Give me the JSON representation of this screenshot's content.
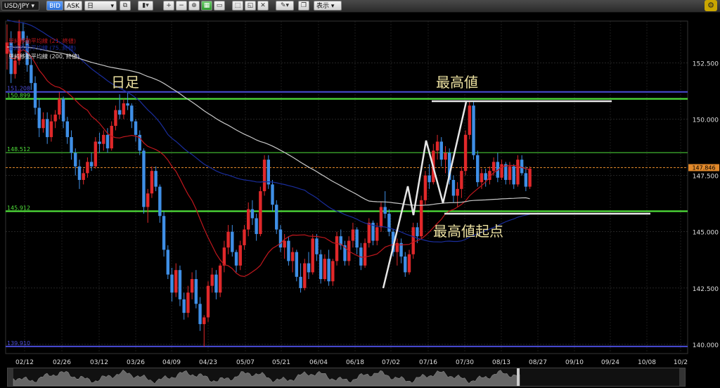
{
  "toolbar": {
    "symbol": "USD/JPY",
    "bid": "BID",
    "ask": "ASK",
    "period": "日",
    "display": "表示"
  },
  "colors": {
    "bull": "#e0282a",
    "bear": "#3f8fe6",
    "ma21": "#c0171d",
    "ma75": "#1a2d9c",
    "ma200": "#c8c8c8",
    "green_line": "#4fe03a",
    "blue_line": "#4a4cd6",
    "annotation": "#ebe0a0"
  },
  "chart_data": {
    "type": "candlestick",
    "instrument": "USD/JPY",
    "timeframe": "daily",
    "ylim": [
      139.9,
      154.5
    ],
    "yticks": [
      "152.500",
      "150.000",
      "147.500",
      "145.000",
      "142.500",
      "140.000"
    ],
    "xticks": [
      "02/12",
      "02/26",
      "03/12",
      "03/26",
      "04/09",
      "04/23",
      "05/07",
      "05/21",
      "06/04",
      "06/18",
      "07/02",
      "07/16",
      "07/30",
      "08/13",
      "08/27",
      "09/10",
      "09/24",
      "10/08",
      "10/2"
    ],
    "legend": [
      {
        "label": "単純移動平均線 (21, 終値)",
        "color": "#c0171d"
      },
      {
        "label": "単純移動平均線 (75, 終値)",
        "color": "#1a2d9c"
      },
      {
        "label": "単純移動平均線 (200, 終値)",
        "color": "#e0e0e0"
      }
    ],
    "horizontal_lines": [
      {
        "label": "151.208",
        "value": 151.208,
        "color": "#4a4cd6"
      },
      {
        "label": "150.899",
        "value": 150.899,
        "color": "#4fe03a"
      },
      {
        "label": "148.512",
        "value": 148.512,
        "color": "#4fe03a"
      },
      {
        "label": "147.846",
        "value": 147.846,
        "color": "#e0882a"
      },
      {
        "label": "145.912",
        "value": 145.912,
        "color": "#4fe03a"
      },
      {
        "label": "139.910",
        "value": 139.91,
        "color": "#4a4cd6"
      }
    ],
    "current_price": "147.846",
    "candles": [
      [
        152.9,
        154.2,
        152.2,
        153.4
      ],
      [
        153.4,
        153.9,
        151.6,
        152.0
      ],
      [
        152.0,
        152.8,
        151.8,
        152.6
      ],
      [
        152.6,
        154.4,
        152.4,
        153.9
      ],
      [
        153.9,
        154.3,
        153.2,
        153.5
      ],
      [
        153.5,
        153.7,
        152.1,
        152.4
      ],
      [
        152.4,
        152.8,
        151.3,
        151.6
      ],
      [
        151.6,
        151.9,
        150.2,
        150.5
      ],
      [
        150.5,
        150.9,
        149.2,
        149.6
      ],
      [
        149.6,
        150.3,
        149.4,
        150.0
      ],
      [
        150.0,
        150.3,
        148.9,
        149.2
      ],
      [
        149.2,
        150.2,
        149.0,
        149.9
      ],
      [
        149.9,
        150.4,
        149.6,
        150.2
      ],
      [
        150.2,
        151.2,
        150.0,
        150.9
      ],
      [
        150.9,
        151.0,
        149.6,
        149.9
      ],
      [
        149.9,
        150.1,
        148.9,
        149.2
      ],
      [
        149.2,
        149.5,
        148.2,
        148.5
      ],
      [
        148.5,
        148.7,
        147.5,
        147.9
      ],
      [
        147.9,
        148.2,
        146.9,
        147.3
      ],
      [
        147.3,
        147.8,
        147.1,
        147.6
      ],
      [
        147.6,
        148.3,
        147.4,
        148.1
      ],
      [
        148.1,
        148.5,
        147.7,
        147.9
      ],
      [
        147.9,
        149.2,
        147.8,
        149.0
      ],
      [
        149.0,
        149.4,
        148.5,
        148.9
      ],
      [
        148.9,
        149.5,
        148.6,
        149.3
      ],
      [
        149.3,
        149.6,
        148.5,
        148.7
      ],
      [
        148.7,
        149.9,
        148.6,
        149.7
      ],
      [
        149.7,
        150.6,
        149.5,
        150.4
      ],
      [
        150.4,
        151.1,
        150.0,
        150.2
      ],
      [
        150.2,
        150.9,
        150.0,
        150.7
      ],
      [
        150.7,
        151.2,
        150.4,
        150.6
      ],
      [
        150.6,
        150.7,
        149.6,
        149.9
      ],
      [
        149.9,
        150.0,
        149.0,
        149.3
      ],
      [
        149.3,
        149.5,
        148.4,
        148.6
      ],
      [
        148.6,
        148.7,
        145.8,
        146.1
      ],
      [
        146.1,
        146.9,
        145.4,
        146.7
      ],
      [
        146.7,
        147.9,
        146.5,
        147.7
      ],
      [
        147.7,
        147.9,
        146.8,
        147.0
      ],
      [
        147.0,
        147.1,
        145.4,
        145.7
      ],
      [
        145.7,
        145.9,
        143.9,
        144.2
      ],
      [
        144.2,
        144.4,
        142.9,
        143.1
      ],
      [
        143.1,
        143.4,
        141.9,
        142.3
      ],
      [
        142.3,
        143.6,
        142.1,
        143.3
      ],
      [
        143.3,
        143.5,
        141.7,
        142.0
      ],
      [
        142.0,
        142.3,
        141.1,
        141.4
      ],
      [
        141.4,
        142.6,
        141.2,
        142.3
      ],
      [
        142.3,
        143.2,
        142.0,
        142.9
      ],
      [
        142.9,
        143.3,
        141.6,
        141.8
      ],
      [
        141.8,
        142.1,
        140.6,
        140.9
      ],
      [
        140.9,
        141.3,
        139.9,
        141.2
      ],
      [
        141.2,
        142.8,
        141.0,
        142.6
      ],
      [
        142.6,
        143.4,
        142.3,
        143.1
      ],
      [
        143.1,
        143.3,
        142.0,
        142.3
      ],
      [
        142.3,
        143.6,
        142.1,
        143.5
      ],
      [
        143.5,
        144.6,
        143.2,
        144.3
      ],
      [
        144.3,
        145.3,
        144.0,
        145.0
      ],
      [
        145.0,
        145.3,
        143.9,
        144.1
      ],
      [
        144.1,
        144.2,
        143.2,
        143.5
      ],
      [
        143.5,
        144.6,
        143.3,
        144.4
      ],
      [
        144.4,
        145.3,
        144.2,
        145.1
      ],
      [
        145.1,
        146.3,
        144.8,
        146.0
      ],
      [
        146.0,
        146.4,
        145.3,
        145.6
      ],
      [
        145.6,
        145.8,
        144.6,
        144.9
      ],
      [
        144.9,
        147.0,
        144.8,
        146.8
      ],
      [
        146.8,
        148.4,
        146.6,
        148.2
      ],
      [
        148.2,
        148.4,
        146.9,
        147.1
      ],
      [
        147.1,
        147.3,
        145.9,
        146.2
      ],
      [
        146.2,
        146.4,
        144.9,
        145.1
      ],
      [
        145.1,
        145.3,
        144.1,
        144.3
      ],
      [
        144.3,
        144.9,
        143.8,
        144.6
      ],
      [
        144.6,
        144.8,
        143.5,
        143.7
      ],
      [
        143.7,
        144.3,
        143.2,
        144.1
      ],
      [
        144.1,
        144.2,
        142.8,
        143.0
      ],
      [
        143.0,
        143.6,
        142.3,
        142.5
      ],
      [
        142.5,
        143.8,
        142.4,
        143.6
      ],
      [
        143.6,
        144.1,
        142.9,
        143.2
      ],
      [
        143.2,
        144.9,
        143.1,
        144.7
      ],
      [
        144.7,
        144.9,
        143.7,
        144.0
      ],
      [
        144.0,
        144.2,
        142.7,
        142.9
      ],
      [
        142.9,
        144.0,
        142.8,
        143.8
      ],
      [
        143.8,
        144.2,
        142.6,
        142.8
      ],
      [
        142.8,
        143.8,
        142.6,
        143.7
      ],
      [
        143.7,
        145.0,
        143.5,
        144.8
      ],
      [
        144.8,
        145.1,
        144.2,
        144.4
      ],
      [
        144.4,
        144.6,
        143.5,
        143.7
      ],
      [
        143.7,
        144.8,
        143.5,
        144.6
      ],
      [
        144.6,
        145.4,
        144.3,
        145.1
      ],
      [
        145.1,
        145.2,
        144.0,
        144.3
      ],
      [
        144.3,
        144.5,
        143.3,
        143.5
      ],
      [
        143.5,
        144.7,
        143.4,
        144.5
      ],
      [
        144.5,
        145.6,
        144.3,
        145.4
      ],
      [
        145.4,
        145.5,
        144.4,
        144.6
      ],
      [
        144.6,
        145.4,
        144.4,
        145.2
      ],
      [
        145.2,
        146.3,
        145.0,
        146.1
      ],
      [
        146.1,
        146.8,
        145.6,
        145.8
      ],
      [
        145.8,
        146.0,
        144.8,
        145.0
      ],
      [
        145.0,
        145.1,
        143.9,
        144.1
      ],
      [
        144.1,
        144.7,
        143.5,
        144.5
      ],
      [
        144.5,
        144.7,
        143.6,
        143.9
      ],
      [
        143.9,
        144.1,
        143.0,
        143.2
      ],
      [
        143.2,
        144.2,
        143.1,
        144.0
      ],
      [
        144.0,
        145.4,
        143.8,
        145.2
      ],
      [
        145.2,
        145.4,
        144.5,
        144.8
      ],
      [
        144.8,
        146.6,
        144.7,
        146.4
      ],
      [
        146.4,
        147.7,
        146.2,
        147.5
      ],
      [
        147.5,
        148.0,
        146.9,
        147.2
      ],
      [
        147.2,
        148.9,
        147.1,
        148.6
      ],
      [
        148.6,
        149.3,
        148.2,
        149.0
      ],
      [
        149.0,
        149.2,
        147.9,
        148.2
      ],
      [
        148.2,
        148.8,
        147.6,
        148.5
      ],
      [
        148.5,
        148.7,
        147.1,
        147.3
      ],
      [
        147.3,
        147.5,
        146.3,
        146.6
      ],
      [
        146.6,
        147.2,
        146.1,
        146.9
      ],
      [
        146.9,
        147.9,
        146.5,
        147.7
      ],
      [
        147.7,
        149.5,
        147.5,
        149.3
      ],
      [
        149.3,
        150.8,
        149.1,
        150.6
      ],
      [
        150.6,
        150.8,
        148.2,
        148.4
      ],
      [
        148.4,
        148.6,
        147.0,
        147.2
      ],
      [
        147.2,
        147.8,
        146.9,
        147.6
      ],
      [
        147.6,
        147.8,
        147.0,
        147.3
      ],
      [
        147.3,
        147.9,
        147.1,
        147.7
      ],
      [
        147.7,
        148.3,
        147.5,
        148.1
      ],
      [
        148.1,
        148.5,
        147.2,
        147.4
      ],
      [
        147.4,
        148.2,
        147.3,
        148.0
      ],
      [
        148.0,
        148.1,
        147.1,
        147.3
      ],
      [
        147.3,
        148.1,
        147.1,
        147.9
      ],
      [
        147.9,
        148.0,
        146.9,
        147.1
      ],
      [
        147.1,
        148.4,
        147.0,
        148.2
      ],
      [
        148.2,
        148.4,
        147.5,
        147.6
      ],
      [
        147.6,
        147.9,
        146.8,
        147.0
      ],
      [
        147.0,
        147.9,
        146.9,
        147.8
      ]
    ]
  },
  "annotations": {
    "timeframe": "日足",
    "high": "最高値",
    "high_origin": "最高値起点"
  }
}
